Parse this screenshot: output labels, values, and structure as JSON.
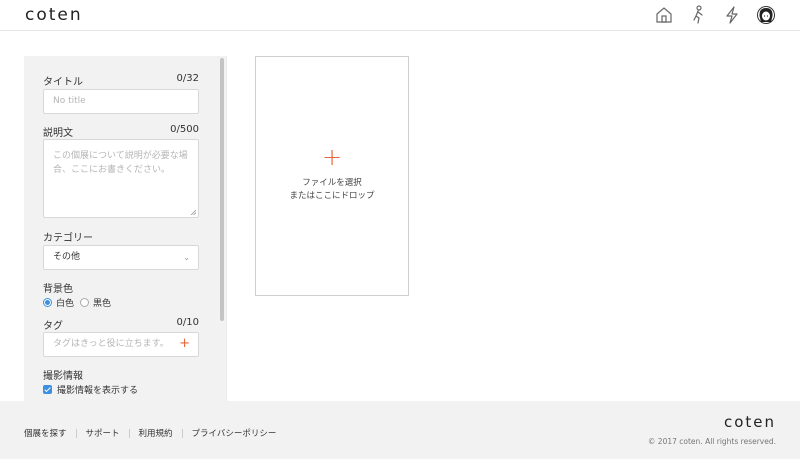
{
  "header": {
    "logo": "coten",
    "icons": [
      "home-icon",
      "walking-person-icon",
      "lightning-icon",
      "user-avatar-icon"
    ]
  },
  "form": {
    "title": {
      "label": "タイトル",
      "count": "0/32",
      "placeholder": "No title"
    },
    "description": {
      "label": "説明文",
      "count": "0/500",
      "placeholder": "この個展について説明が必要な場合、ここにお書きください。"
    },
    "category": {
      "label": "カテゴリー",
      "selected": "その他"
    },
    "background": {
      "label": "背景色",
      "options": [
        "白色",
        "黒色"
      ],
      "selected": "白色"
    },
    "tags": {
      "label": "タグ",
      "count": "0/10",
      "placeholder": "タグはきっと役に立ちます。"
    },
    "photo_info": {
      "label": "撮影情報",
      "checkbox_label": "撮影情報を表示する",
      "checked": true
    }
  },
  "upload": {
    "line1": "ファイルを選択",
    "line2": "またはここにドロップ"
  },
  "footer": {
    "links": [
      "個展を探す",
      "サポート",
      "利用規約",
      "プライバシーポリシー"
    ],
    "logo": "coten",
    "copyright": "© 2017 coten. All rights reserved."
  },
  "colors": {
    "accent": "#e8653a",
    "checkbox_blue": "#3d8fe0",
    "panel_bg": "#f2f2f2"
  }
}
